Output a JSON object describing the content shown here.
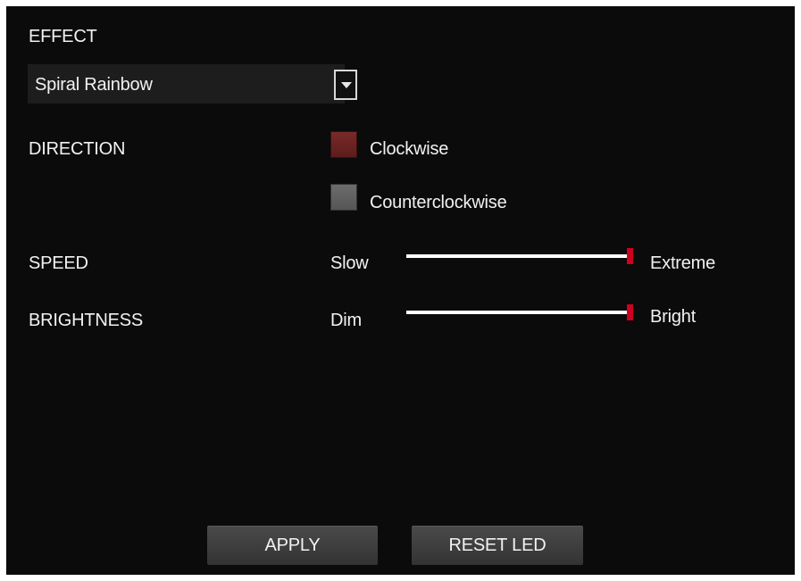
{
  "effect": {
    "heading": "EFFECT",
    "selected": "Spiral Rainbow"
  },
  "direction": {
    "heading": "DIRECTION",
    "options": [
      {
        "label": "Clockwise",
        "selected": true
      },
      {
        "label": "Counterclockwise",
        "selected": false
      }
    ]
  },
  "speed": {
    "heading": "SPEED",
    "min_label": "Slow",
    "max_label": "Extreme",
    "value_fraction": 1.0
  },
  "brightness": {
    "heading": "BRIGHTNESS",
    "min_label": "Dim",
    "max_label": "Bright",
    "value_fraction": 1.0
  },
  "buttons": {
    "apply": "APPLY",
    "reset": "RESET LED"
  },
  "colors": {
    "background": "#0b0b0b",
    "accent": "#d0001f",
    "selected_radio": "#6b2222",
    "unselected_radio": "#606060"
  }
}
